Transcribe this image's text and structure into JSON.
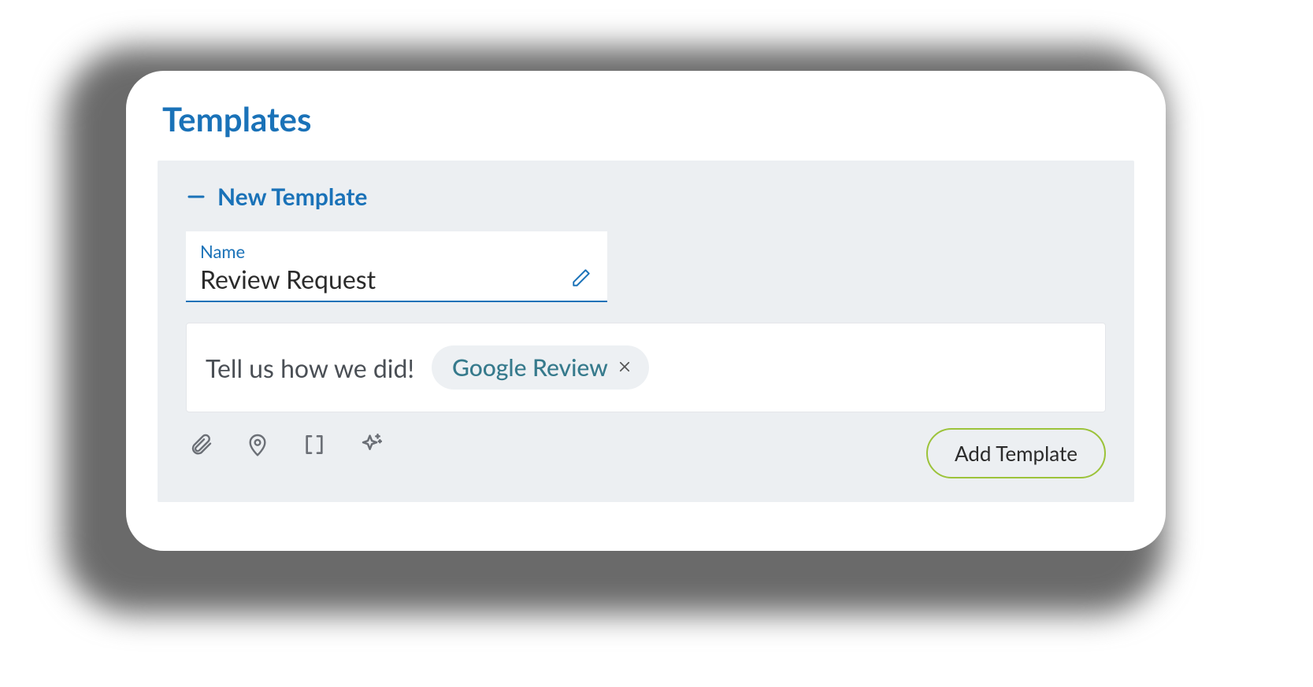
{
  "colors": {
    "primary": "#1a72b8",
    "accent": "#9cc33a",
    "chipText": "#367a8c"
  },
  "page": {
    "title": "Templates"
  },
  "panel": {
    "header": "New Template",
    "name_label": "Name",
    "name_value": "Review Request",
    "message_text": "Tell us how we did!",
    "chip": {
      "label": "Google Review"
    },
    "add_button": "Add Template"
  },
  "icons": {
    "collapse": "dash-icon",
    "edit": "pencil-icon",
    "close": "chip-close-icon",
    "attach": "paperclip-icon",
    "location": "location-pin-icon",
    "brackets": "brackets-icon",
    "sparkle": "star-sparkle-icon"
  }
}
